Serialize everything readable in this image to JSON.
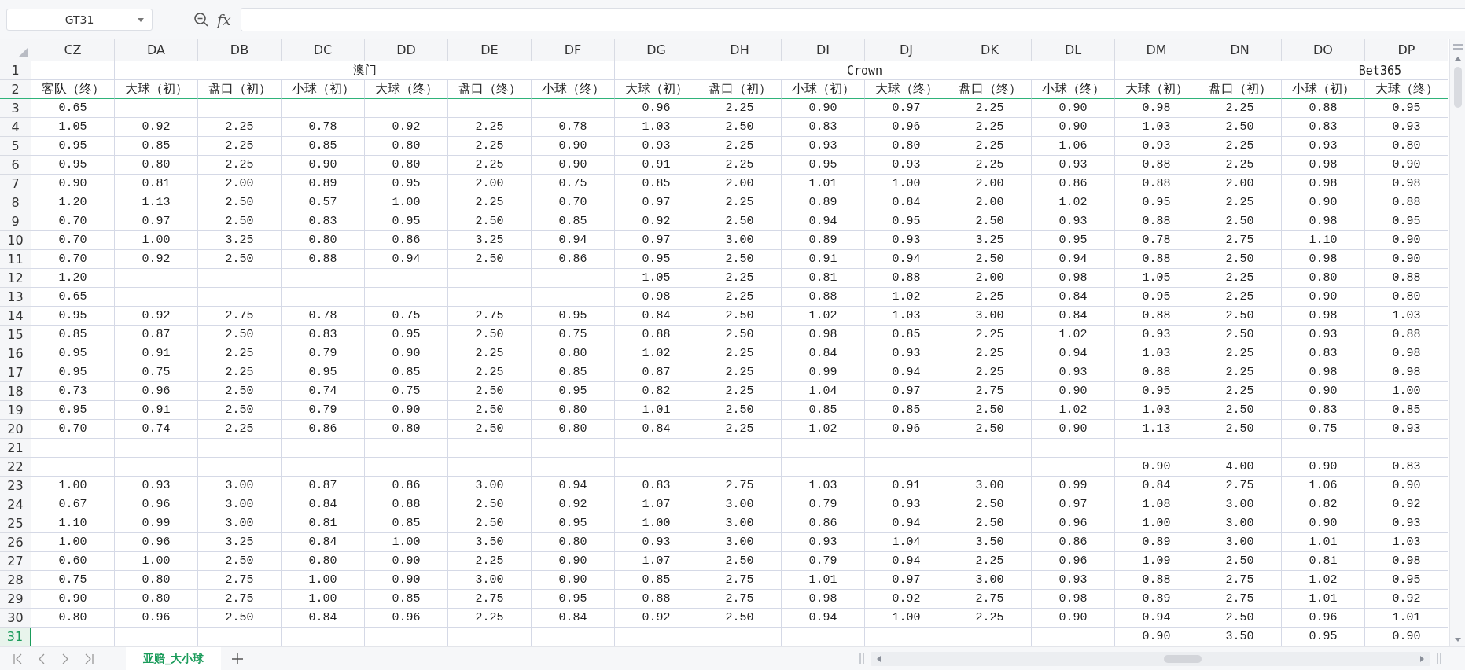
{
  "name_box": "GT31",
  "fx_label": "fx",
  "sections": [
    {
      "columns": [
        {
          "letter": "CZ",
          "heading": "客队（终）"
        }
      ]
    },
    {
      "title": "澳门",
      "columns": [
        {
          "letter": "DA",
          "heading": "大球（初）"
        },
        {
          "letter": "DB",
          "heading": "盘口（初）"
        },
        {
          "letter": "DC",
          "heading": "小球（初）"
        },
        {
          "letter": "DD",
          "heading": "大球（终）"
        },
        {
          "letter": "DE",
          "heading": "盘口（终）"
        },
        {
          "letter": "DF",
          "heading": "小球（终）"
        }
      ]
    },
    {
      "title": "Crown",
      "columns": [
        {
          "letter": "DG",
          "heading": "大球（初）"
        },
        {
          "letter": "DH",
          "heading": "盘口（初）"
        },
        {
          "letter": "DI",
          "heading": "小球（初）"
        },
        {
          "letter": "DJ",
          "heading": "大球（终）"
        },
        {
          "letter": "DK",
          "heading": "盘口（终）"
        },
        {
          "letter": "DL",
          "heading": "小球（终）"
        }
      ]
    },
    {
      "title": "Bet365",
      "continues": true,
      "columns": [
        {
          "letter": "DM",
          "heading": "大球（初）"
        },
        {
          "letter": "DN",
          "heading": "盘口（初）"
        },
        {
          "letter": "DO",
          "heading": "小球（初）"
        },
        {
          "letter": "DP",
          "heading": "大球（终）"
        }
      ]
    }
  ],
  "header_rows": [
    {
      "number": "1",
      "selected": false
    },
    {
      "number": "2",
      "selected": false
    }
  ],
  "rows": [
    {
      "number": "3",
      "selected": false,
      "cells": [
        "0.65",
        null,
        null,
        null,
        null,
        null,
        null,
        "0.96",
        "2.25",
        "0.90",
        "0.97",
        "2.25",
        "0.90",
        "0.98",
        "2.25",
        "0.88",
        "0.95"
      ]
    },
    {
      "number": "4",
      "selected": false,
      "cells": [
        "1.05",
        "0.92",
        "2.25",
        "0.78",
        "0.92",
        "2.25",
        "0.78",
        "1.03",
        "2.50",
        "0.83",
        "0.96",
        "2.25",
        "0.90",
        "1.03",
        "2.50",
        "0.83",
        "0.93"
      ]
    },
    {
      "number": "5",
      "selected": false,
      "cells": [
        "0.95",
        "0.85",
        "2.25",
        "0.85",
        "0.80",
        "2.25",
        "0.90",
        "0.93",
        "2.25",
        "0.93",
        "0.80",
        "2.25",
        "1.06",
        "0.93",
        "2.25",
        "0.93",
        "0.80"
      ]
    },
    {
      "number": "6",
      "selected": false,
      "cells": [
        "0.95",
        "0.80",
        "2.25",
        "0.90",
        "0.80",
        "2.25",
        "0.90",
        "0.91",
        "2.25",
        "0.95",
        "0.93",
        "2.25",
        "0.93",
        "0.88",
        "2.25",
        "0.98",
        "0.90"
      ]
    },
    {
      "number": "7",
      "selected": false,
      "cells": [
        "0.90",
        "0.81",
        "2.00",
        "0.89",
        "0.95",
        "2.00",
        "0.75",
        "0.85",
        "2.00",
        "1.01",
        "1.00",
        "2.00",
        "0.86",
        "0.88",
        "2.00",
        "0.98",
        "0.98"
      ]
    },
    {
      "number": "8",
      "selected": false,
      "cells": [
        "1.20",
        "1.13",
        "2.50",
        "0.57",
        "1.00",
        "2.25",
        "0.70",
        "0.97",
        "2.25",
        "0.89",
        "0.84",
        "2.00",
        "1.02",
        "0.95",
        "2.25",
        "0.90",
        "0.88"
      ]
    },
    {
      "number": "9",
      "selected": false,
      "cells": [
        "0.70",
        "0.97",
        "2.50",
        "0.83",
        "0.95",
        "2.50",
        "0.85",
        "0.92",
        "2.50",
        "0.94",
        "0.95",
        "2.50",
        "0.93",
        "0.88",
        "2.50",
        "0.98",
        "0.95"
      ]
    },
    {
      "number": "10",
      "selected": false,
      "cells": [
        "0.70",
        "1.00",
        "3.25",
        "0.80",
        "0.86",
        "3.25",
        "0.94",
        "0.97",
        "3.00",
        "0.89",
        "0.93",
        "3.25",
        "0.95",
        "0.78",
        "2.75",
        "1.10",
        "0.90"
      ]
    },
    {
      "number": "11",
      "selected": false,
      "cells": [
        "0.70",
        "0.92",
        "2.50",
        "0.88",
        "0.94",
        "2.50",
        "0.86",
        "0.95",
        "2.50",
        "0.91",
        "0.94",
        "2.50",
        "0.94",
        "0.88",
        "2.50",
        "0.98",
        "0.90"
      ]
    },
    {
      "number": "12",
      "selected": false,
      "cells": [
        "1.20",
        null,
        null,
        null,
        null,
        null,
        null,
        "1.05",
        "2.25",
        "0.81",
        "0.88",
        "2.00",
        "0.98",
        "1.05",
        "2.25",
        "0.80",
        "0.88"
      ]
    },
    {
      "number": "13",
      "selected": false,
      "cells": [
        "0.65",
        null,
        null,
        null,
        null,
        null,
        null,
        "0.98",
        "2.25",
        "0.88",
        "1.02",
        "2.25",
        "0.84",
        "0.95",
        "2.25",
        "0.90",
        "0.80"
      ]
    },
    {
      "number": "14",
      "selected": false,
      "cells": [
        "0.95",
        "0.92",
        "2.75",
        "0.78",
        "0.75",
        "2.75",
        "0.95",
        "0.84",
        "2.50",
        "1.02",
        "1.03",
        "3.00",
        "0.84",
        "0.88",
        "2.50",
        "0.98",
        "1.03"
      ]
    },
    {
      "number": "15",
      "selected": false,
      "cells": [
        "0.85",
        "0.87",
        "2.50",
        "0.83",
        "0.95",
        "2.50",
        "0.75",
        "0.88",
        "2.50",
        "0.98",
        "0.85",
        "2.25",
        "1.02",
        "0.93",
        "2.50",
        "0.93",
        "0.88"
      ]
    },
    {
      "number": "16",
      "selected": false,
      "cells": [
        "0.95",
        "0.91",
        "2.25",
        "0.79",
        "0.90",
        "2.25",
        "0.80",
        "1.02",
        "2.25",
        "0.84",
        "0.93",
        "2.25",
        "0.94",
        "1.03",
        "2.25",
        "0.83",
        "0.98"
      ]
    },
    {
      "number": "17",
      "selected": false,
      "cells": [
        "0.95",
        "0.75",
        "2.25",
        "0.95",
        "0.85",
        "2.25",
        "0.85",
        "0.87",
        "2.25",
        "0.99",
        "0.94",
        "2.25",
        "0.93",
        "0.88",
        "2.25",
        "0.98",
        "0.98"
      ]
    },
    {
      "number": "18",
      "selected": false,
      "cells": [
        "0.73",
        "0.96",
        "2.50",
        "0.74",
        "0.75",
        "2.50",
        "0.95",
        "0.82",
        "2.25",
        "1.04",
        "0.97",
        "2.75",
        "0.90",
        "0.95",
        "2.25",
        "0.90",
        "1.00"
      ]
    },
    {
      "number": "19",
      "selected": false,
      "cells": [
        "0.95",
        "0.91",
        "2.50",
        "0.79",
        "0.90",
        "2.50",
        "0.80",
        "1.01",
        "2.50",
        "0.85",
        "0.85",
        "2.50",
        "1.02",
        "1.03",
        "2.50",
        "0.83",
        "0.85"
      ]
    },
    {
      "number": "20",
      "selected": false,
      "cells": [
        "0.70",
        "0.74",
        "2.25",
        "0.86",
        "0.80",
        "2.50",
        "0.80",
        "0.84",
        "2.25",
        "1.02",
        "0.96",
        "2.50",
        "0.90",
        "1.13",
        "2.50",
        "0.75",
        "0.93"
      ]
    },
    {
      "number": "21",
      "selected": false,
      "cells": [
        null,
        null,
        null,
        null,
        null,
        null,
        null,
        null,
        null,
        null,
        null,
        null,
        null,
        null,
        null,
        null,
        null
      ]
    },
    {
      "number": "22",
      "selected": false,
      "cells": [
        null,
        null,
        null,
        null,
        null,
        null,
        null,
        null,
        null,
        null,
        null,
        null,
        null,
        "0.90",
        "4.00",
        "0.90",
        "0.83"
      ]
    },
    {
      "number": "23",
      "selected": false,
      "cells": [
        "1.00",
        "0.93",
        "3.00",
        "0.87",
        "0.86",
        "3.00",
        "0.94",
        "0.83",
        "2.75",
        "1.03",
        "0.91",
        "3.00",
        "0.99",
        "0.84",
        "2.75",
        "1.06",
        "0.90"
      ]
    },
    {
      "number": "24",
      "selected": false,
      "cells": [
        "0.67",
        "0.96",
        "3.00",
        "0.84",
        "0.88",
        "2.50",
        "0.92",
        "1.07",
        "3.00",
        "0.79",
        "0.93",
        "2.50",
        "0.97",
        "1.08",
        "3.00",
        "0.82",
        "0.92"
      ]
    },
    {
      "number": "25",
      "selected": false,
      "cells": [
        "1.10",
        "0.99",
        "3.00",
        "0.81",
        "0.85",
        "2.50",
        "0.95",
        "1.00",
        "3.00",
        "0.86",
        "0.94",
        "2.50",
        "0.96",
        "1.00",
        "3.00",
        "0.90",
        "0.93"
      ]
    },
    {
      "number": "26",
      "selected": false,
      "cells": [
        "1.00",
        "0.96",
        "3.25",
        "0.84",
        "1.00",
        "3.50",
        "0.80",
        "0.93",
        "3.00",
        "0.93",
        "1.04",
        "3.50",
        "0.86",
        "0.89",
        "3.00",
        "1.01",
        "1.03"
      ]
    },
    {
      "number": "27",
      "selected": false,
      "cells": [
        "0.60",
        "1.00",
        "2.50",
        "0.80",
        "0.90",
        "2.25",
        "0.90",
        "1.07",
        "2.50",
        "0.79",
        "0.94",
        "2.25",
        "0.96",
        "1.09",
        "2.50",
        "0.81",
        "0.98"
      ]
    },
    {
      "number": "28",
      "selected": false,
      "cells": [
        "0.75",
        "0.80",
        "2.75",
        "1.00",
        "0.90",
        "3.00",
        "0.90",
        "0.85",
        "2.75",
        "1.01",
        "0.97",
        "3.00",
        "0.93",
        "0.88",
        "2.75",
        "1.02",
        "0.95"
      ]
    },
    {
      "number": "29",
      "selected": false,
      "cells": [
        "0.90",
        "0.80",
        "2.75",
        "1.00",
        "0.85",
        "2.75",
        "0.95",
        "0.88",
        "2.75",
        "0.98",
        "0.92",
        "2.75",
        "0.98",
        "0.89",
        "2.75",
        "1.01",
        "0.92"
      ]
    },
    {
      "number": "30",
      "selected": false,
      "cells": [
        "0.80",
        "0.96",
        "2.50",
        "0.84",
        "0.96",
        "2.25",
        "0.84",
        "0.92",
        "2.50",
        "0.94",
        "1.00",
        "2.25",
        "0.90",
        "0.94",
        "2.50",
        "0.96",
        "1.01"
      ]
    },
    {
      "number": "31",
      "selected": true,
      "cells": [
        null,
        null,
        null,
        null,
        null,
        null,
        null,
        null,
        null,
        null,
        null,
        null,
        null,
        "0.90",
        "3.50",
        "0.95",
        "0.90"
      ]
    }
  ],
  "sheet_tabs": [
    {
      "label": "亚赔_大小球",
      "selected": true
    }
  ]
}
